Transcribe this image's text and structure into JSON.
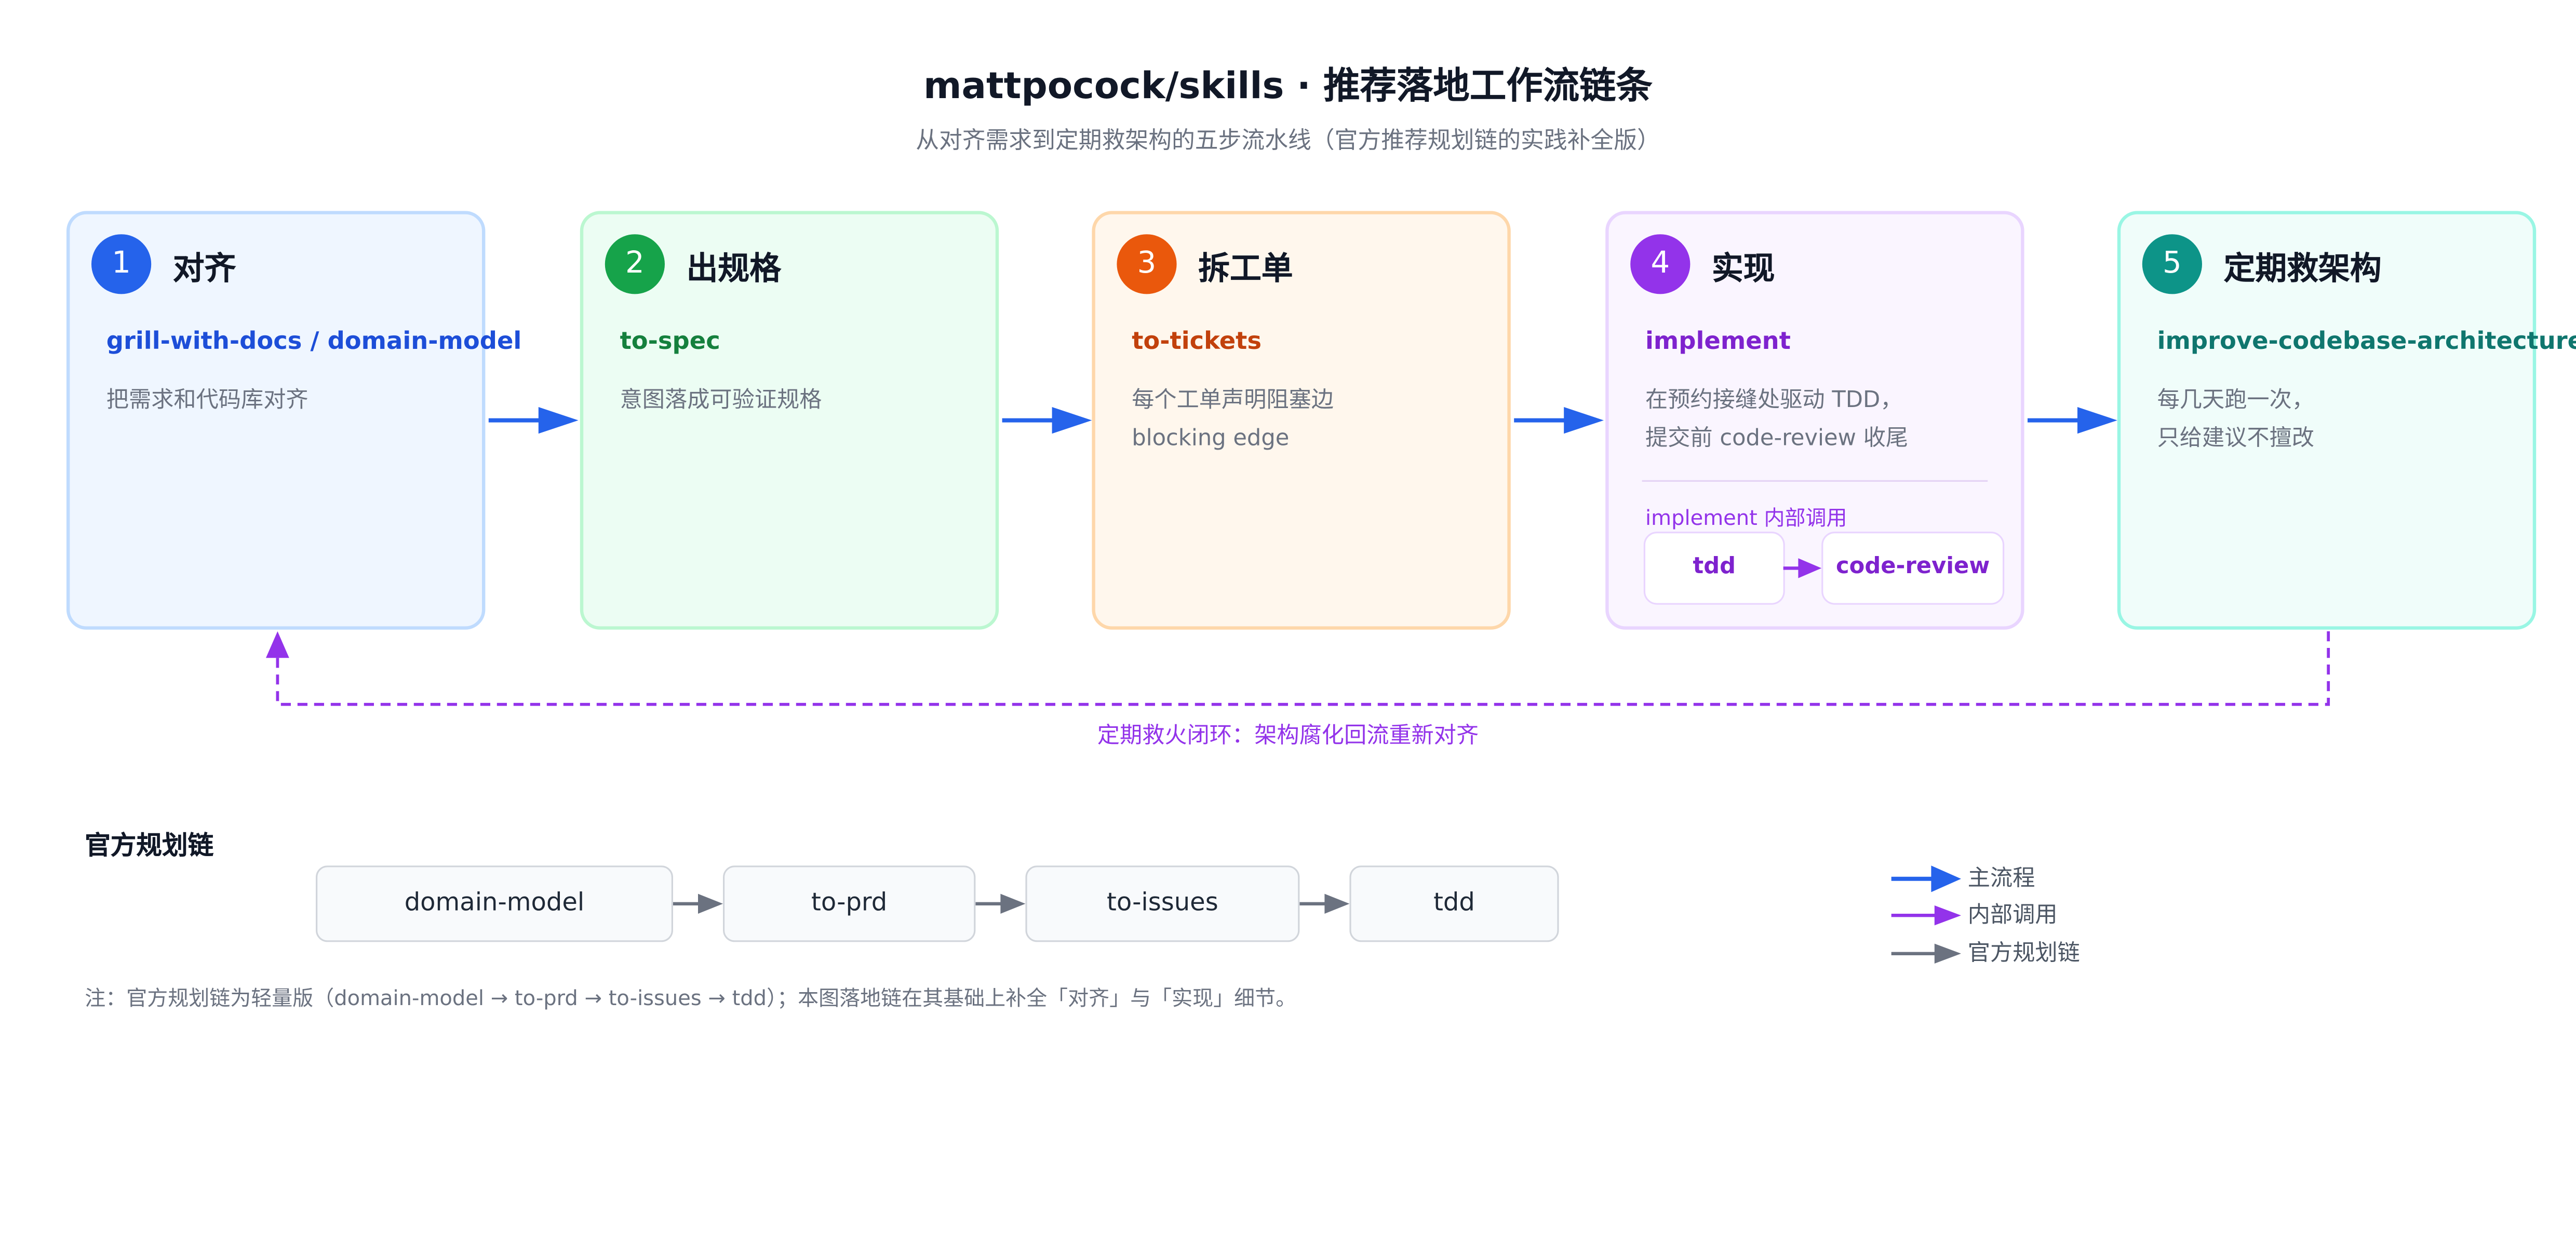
{
  "title": "mattpocock/skills · 推荐落地工作流链条",
  "subtitle": "从对齐需求到定期救架构的五步流水线（官方推荐规划链的实践补全版）",
  "steps": [
    {
      "num": "1",
      "title": "对齐",
      "skill": "grill-with-docs / domain-model",
      "desc": [
        "把需求和代码库对齐"
      ],
      "accent": "#2563eb",
      "skill_color": "#1d4ed8",
      "bg": "#eff6ff",
      "border": "#bfdbfe"
    },
    {
      "num": "2",
      "title": "出规格",
      "skill": "to-spec",
      "desc": [
        "意图落成可验证规格"
      ],
      "accent": "#16a34a",
      "skill_color": "#15803d",
      "bg": "#ecfdf3",
      "border": "#bbf7d0"
    },
    {
      "num": "3",
      "title": "拆工单",
      "skill": "to-tickets",
      "desc": [
        "每个工单声明阻塞边",
        "blocking edge"
      ],
      "accent": "#ea580c",
      "skill_color": "#c2410c",
      "bg": "#fff7ed",
      "border": "#fed7aa"
    },
    {
      "num": "4",
      "title": "实现",
      "skill": "implement",
      "desc": [
        "在预约接缝处驱动 TDD，",
        "提交前 code-review 收尾"
      ],
      "accent": "#9333ea",
      "skill_color": "#7e22ce",
      "bg": "#faf5ff",
      "border": "#e9d5ff"
    },
    {
      "num": "5",
      "title": "定期救架构",
      "skill": "improve-codebase-architecture",
      "desc": [
        "每几天跑一次，",
        "只给建议不擅改"
      ],
      "accent": "#0d9488",
      "skill_color": "#0f766e",
      "bg": "#f0fdfa",
      "border": "#99f6e4"
    }
  ],
  "implement_internal": {
    "label": "implement 内部调用",
    "items": [
      "tdd",
      "code-review"
    ]
  },
  "loop_label": "定期救火闭环：架构腐化回流重新对齐",
  "official_chain": {
    "title": "官方规划链",
    "items": [
      "domain-model",
      "to-prd",
      "to-issues",
      "tdd"
    ]
  },
  "note": "注：官方规划链为轻量版（domain-model → to-prd → to-issues → tdd）；本图落地链在其基础上补全「对齐」与「实现」细节。",
  "legend": [
    {
      "label": "主流程",
      "color": "#2563eb"
    },
    {
      "label": "内部调用",
      "color": "#9333ea"
    },
    {
      "label": "官方规划链",
      "color": "#6b7280"
    }
  ]
}
